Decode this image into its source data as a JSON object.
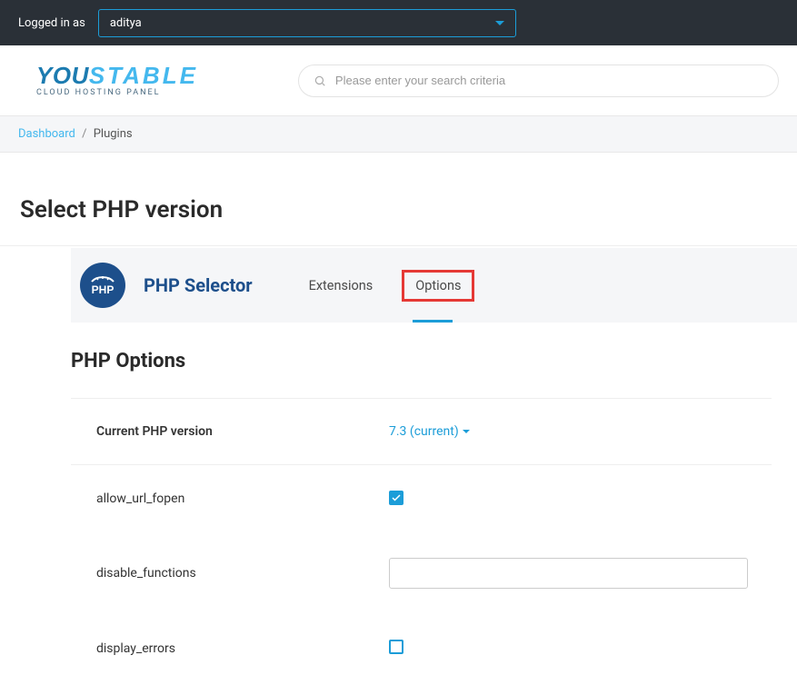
{
  "topbar": {
    "logged_in_label": "Logged in as",
    "username": "aditya"
  },
  "logo": {
    "main_part1": "YOU",
    "main_part2": "STABLE",
    "subtitle": "CLOUD HOSTING PANEL"
  },
  "search": {
    "placeholder": "Please enter your search criteria"
  },
  "breadcrumb": {
    "dashboard": "Dashboard",
    "separator": "/",
    "current": "Plugins"
  },
  "page": {
    "title": "Select PHP version"
  },
  "selector": {
    "title": "PHP Selector",
    "tabs": {
      "extensions": "Extensions",
      "options": "Options"
    }
  },
  "options": {
    "title": "PHP Options",
    "current_version_label": "Current PHP version",
    "current_version_value": "7.3 (current)",
    "rows": {
      "allow_url_fopen": {
        "label": "allow_url_fopen",
        "checked": true
      },
      "disable_functions": {
        "label": "disable_functions",
        "value": ""
      },
      "display_errors": {
        "label": "display_errors",
        "checked": false
      }
    }
  }
}
